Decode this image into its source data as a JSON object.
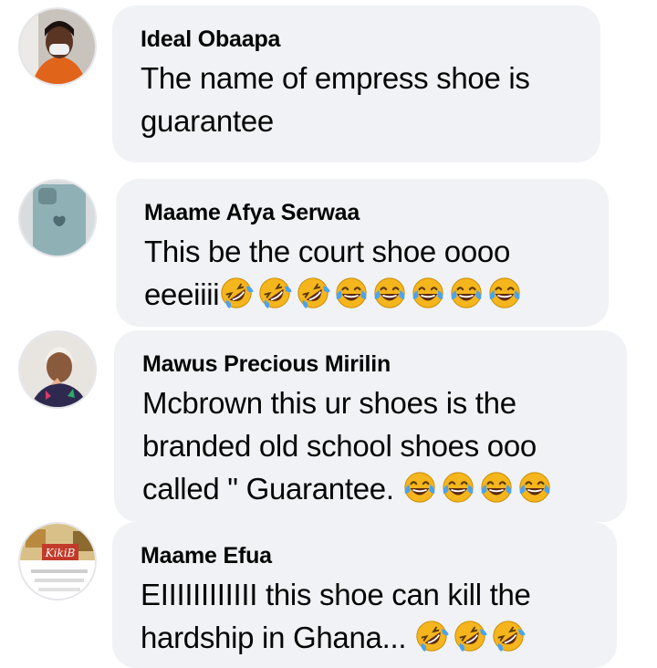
{
  "comments": [
    {
      "name": "Ideal Obaapa",
      "lines": [
        "The name of empress shoe is",
        "guarantee"
      ]
    },
    {
      "name": "Maame Afya Serwaa",
      "lines": [
        "This be the court shoe oooo",
        "eeeiiii"
      ],
      "emojis": [
        "rofl",
        "rofl",
        "rofl",
        "joy",
        "joy",
        "joy",
        "joy",
        "joy"
      ]
    },
    {
      "name": "Mawus Precious Mirilin",
      "lines": [
        "Mcbrown this ur shoes is the",
        "branded old school shoes ooo",
        "called \" Guarantee."
      ],
      "emojis": [
        "joy",
        "joy",
        "joy",
        "joy"
      ]
    },
    {
      "name": "Maame Efua",
      "lines": [
        "EIIIIIIIIIIII this shoe can kill the",
        "hardship in Ghana..."
      ],
      "emojis": [
        "rofl",
        "rofl",
        "rofl"
      ],
      "avatar_text": "KikiB"
    }
  ],
  "emoji_icons": {
    "rofl": "rolling-on-floor-laughing-emoji",
    "joy": "face-with-tears-of-joy-emoji"
  },
  "colors": {
    "bubble": "#f0f2f5",
    "text": "#050505",
    "emoji_face": "#f5b51d",
    "emoji_tears": "#4aa3f0"
  }
}
